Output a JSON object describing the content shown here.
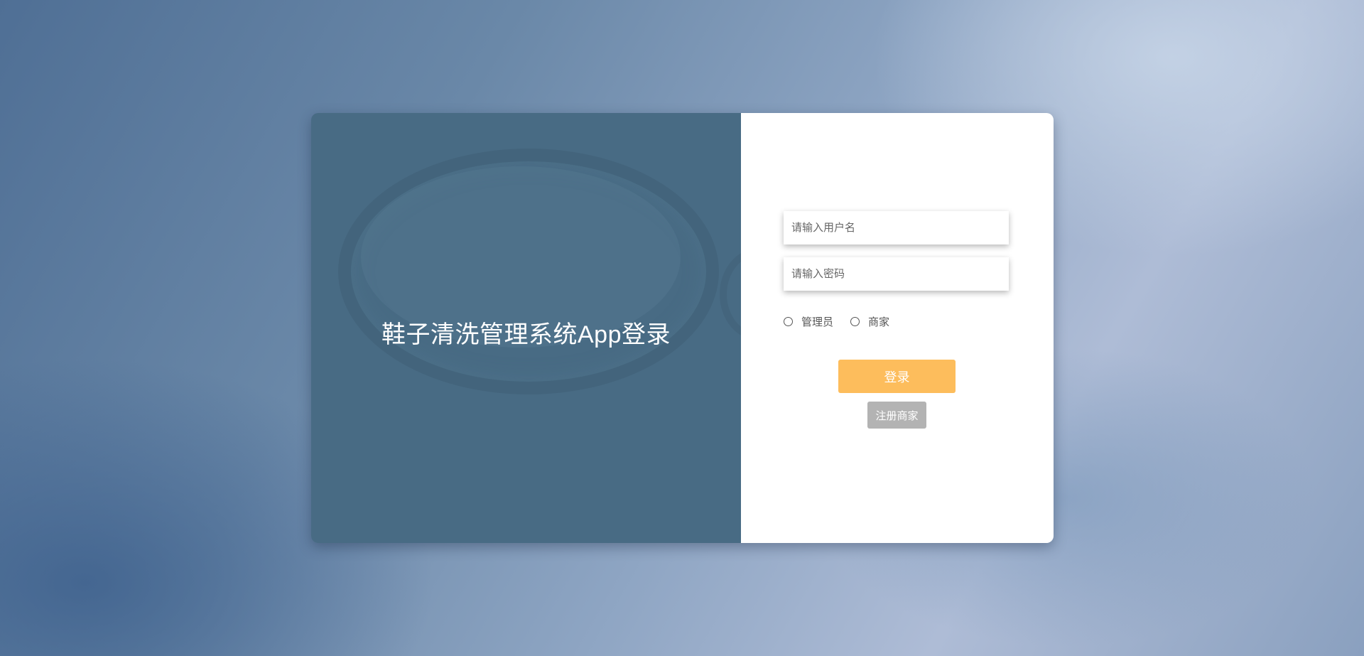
{
  "app": {
    "title": "鞋子清洗管理系统App登录"
  },
  "login_form": {
    "username_placeholder": "请输入用户名",
    "password_placeholder": "请输入密码",
    "roles": [
      {
        "label": "管理员",
        "selected": false
      },
      {
        "label": "商家",
        "selected": false
      }
    ],
    "login_label": "登录",
    "register_label": "注册商家"
  },
  "colors": {
    "left_panel": "#486b84",
    "login_button": "#fdbd5c",
    "register_button": "#b3b3b3"
  }
}
